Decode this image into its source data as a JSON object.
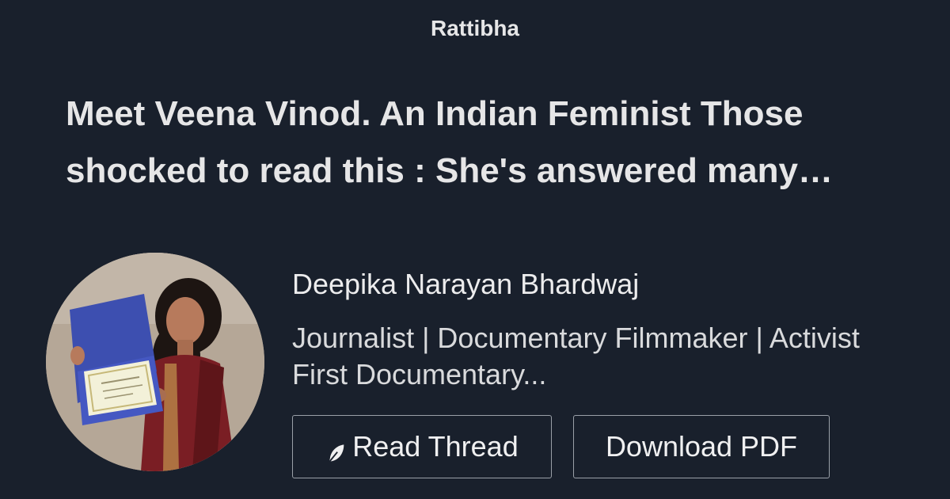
{
  "header": {
    "brand": "Rattibha"
  },
  "thread": {
    "title_line_1": "Meet Veena Vinod. An Indian Feminist Those",
    "title_line_2": "shocked to read this : She's answered many…"
  },
  "author": {
    "name": "Deepika Narayan Bhardwaj",
    "bio_line_1": "Journalist | Documentary Filmmaker | Activist",
    "bio_line_2": "First Documentary..."
  },
  "actions": {
    "read_label": "Read Thread",
    "read_icon": "feather-icon",
    "pdf_label": "Download PDF"
  },
  "colors": {
    "background": "#19202c",
    "text": "#e6e6e7",
    "button_border": "#9aa0a8"
  }
}
